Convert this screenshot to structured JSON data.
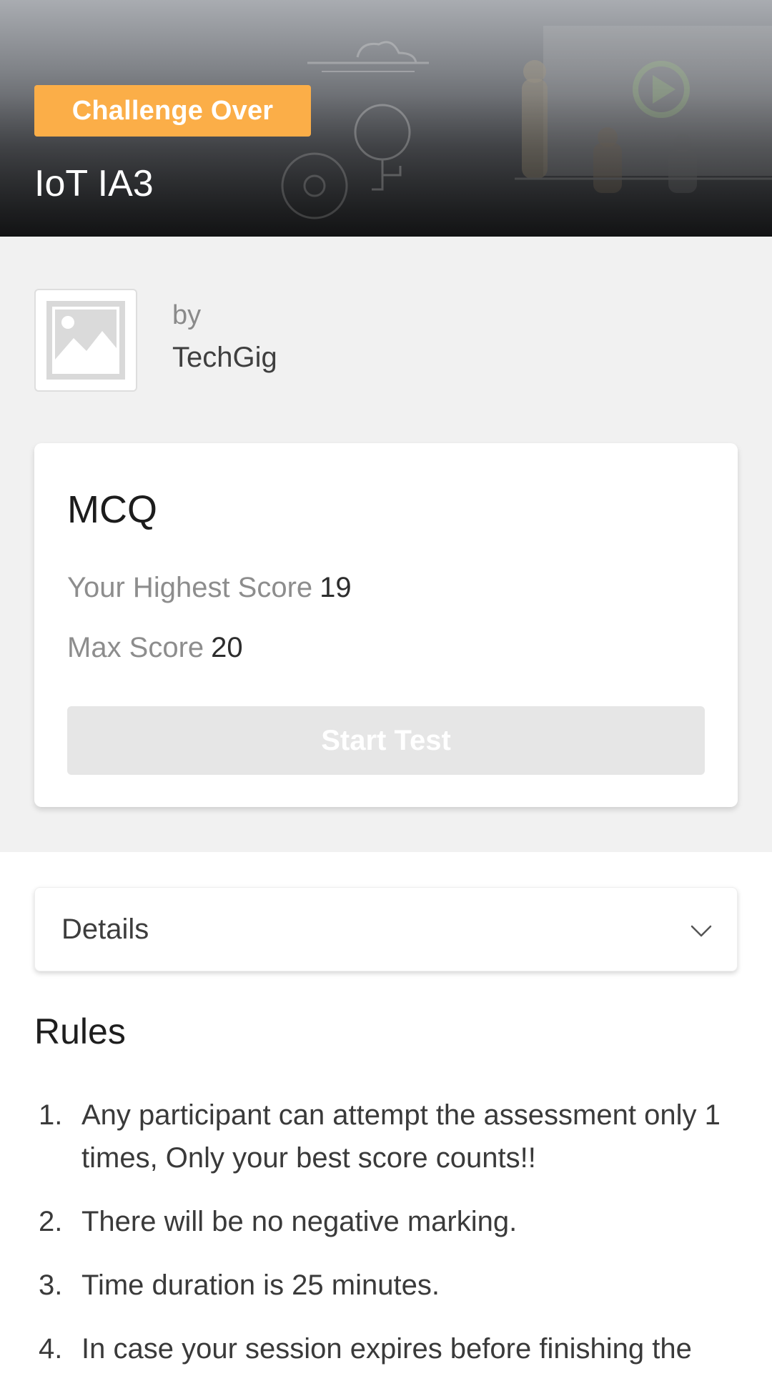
{
  "header": {
    "badge": "Challenge Over",
    "title": "IoT IA3"
  },
  "organizer": {
    "by_label": "by",
    "name": "TechGig"
  },
  "test_card": {
    "title": "MCQ",
    "highest_score_label": "Your Highest Score",
    "highest_score_value": "19",
    "max_score_label": "Max Score",
    "max_score_value": "20",
    "start_button": "Start Test"
  },
  "details": {
    "label": "Details",
    "icon": "chevron-down-icon"
  },
  "rules": {
    "title": "Rules",
    "items": [
      {
        "num": "1.",
        "text": "Any participant can attempt the assessment only 1 times, Only your best score counts!!"
      },
      {
        "num": "2.",
        "text": "There will be no negative marking."
      },
      {
        "num": "3.",
        "text": "Time duration is 25 minutes."
      },
      {
        "num": "4.",
        "text": "In case your session expires before finishing the"
      }
    ]
  },
  "colors": {
    "badge": "#fbae48",
    "page_gray": "#f1f1f1",
    "disabled_button": "#e6e6e6"
  }
}
